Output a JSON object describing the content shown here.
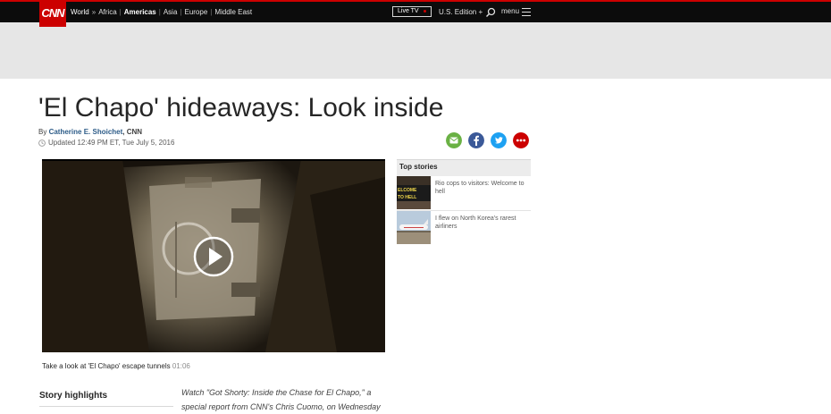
{
  "header": {
    "logo": "CNN",
    "nav_world": "World",
    "nav_arrow": "»",
    "regions": [
      "Africa",
      "Americas",
      "Asia",
      "Europe",
      "Middle East"
    ],
    "active_region": "Americas",
    "live_tv": "Live TV",
    "edition": "U.S. Edition",
    "edition_caret": "+",
    "menu": "menu",
    "colors": {
      "top_bar": "#0c0c0c",
      "brand_red": "#cc0000",
      "ad_band": "#e6e6e6"
    }
  },
  "article": {
    "headline": "'El Chapo' hideaways: Look inside",
    "by": "By",
    "author": "Catherine E. Shoichet",
    "publisher": ", CNN",
    "updated": "Updated 12:49 PM ET, Tue July 5, 2016",
    "share_icons": [
      "email-icon",
      "facebook-icon",
      "twitter-icon",
      "more-icon"
    ],
    "share_colors": [
      "#6ab144",
      "#3b5998",
      "#1da1f2",
      "#cc0000"
    ],
    "video_caption": "Take a look at 'El Chapo' escape tunnels",
    "video_duration": "01:06",
    "story_highlights": "Story highlights",
    "body_line1": "Watch \"Got Shorty: Inside the Chase for El Chapo,\" a",
    "body_line2": "special report from CNN's Chris Cuomo, on Wednesday"
  },
  "sidebar": {
    "heading": "Top stories",
    "stories": [
      {
        "title": "Rio cops to visitors: Welcome to hell"
      },
      {
        "title": "I flew on North Korea's rarest airliners"
      }
    ]
  }
}
